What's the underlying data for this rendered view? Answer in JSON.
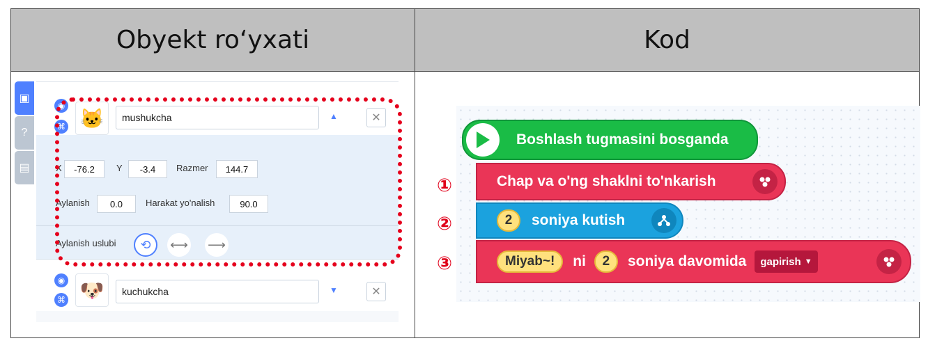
{
  "headers": {
    "left": "Obyekt ro‘yxati",
    "right": "Kod"
  },
  "objects": [
    {
      "name": "mushukcha",
      "thumb_icon": "cat-sprite-icon",
      "expanded": true
    },
    {
      "name": "kuchukcha",
      "thumb_icon": "dog-sprite-icon",
      "expanded": false
    }
  ],
  "props": {
    "x_label": "X",
    "x_value": "-76.2",
    "y_label": "Y",
    "y_value": "-3.4",
    "size_label": "Razmer",
    "size_value": "144.7",
    "rotation_label": "Aylanish",
    "rotation_value": "0.0",
    "direction_label": "Harakat yo'nalish",
    "direction_value": "90.0",
    "rotation_style_label": "Aylanish uslubi"
  },
  "code": {
    "markers": [
      "①",
      "②",
      "③"
    ],
    "start_block": "Boshlash tugmasini bosganda",
    "block1": "Chap va o'ng shaklni to'nkarish",
    "block2_value": "2",
    "block2_text": "soniya kutish",
    "block3_text_value": "Miyab~!",
    "block3_ni": "ni",
    "block3_seconds": "2",
    "block3_mid": "soniya davomida",
    "block3_dropdown": "gapirish"
  },
  "colors": {
    "header_bg": "#bfbfbf",
    "accent": "#4f80ff",
    "highlight_dashed": "#e5001c",
    "start_block": "#1abc46",
    "looks_block": "#ea3557",
    "flow_block": "#1ba2de"
  }
}
